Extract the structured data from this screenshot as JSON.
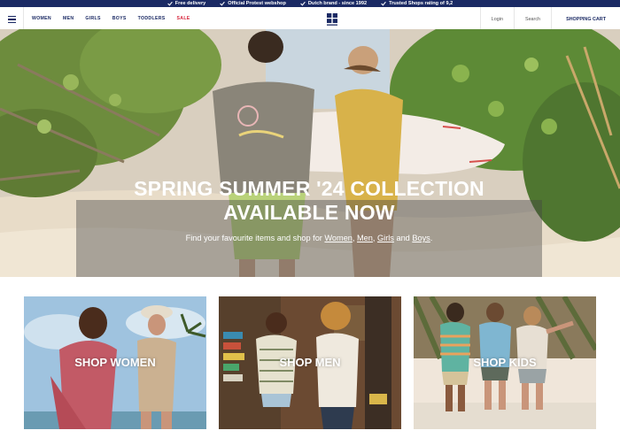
{
  "usp_bar": {
    "items": [
      "Free delivery",
      "Official Protest webshop",
      "Dutch brand - since 1992",
      "Trusted Shops rating of 9,2"
    ]
  },
  "header": {
    "nav": [
      "WOMEN",
      "MEN",
      "GIRLS",
      "BOYS",
      "TODDLERS",
      "SALE"
    ],
    "logo_text": "PROTEST",
    "login": "Login",
    "search": "Search",
    "cart": "SHOPPING CART"
  },
  "hero": {
    "title_line1": "SPRING SUMMER '24 COLLECTION",
    "title_line2": "AVAILABLE NOW",
    "subtitle_prefix": "Find your favourite items and shop for ",
    "links": [
      "Women",
      "Men",
      "Girls",
      "Boys"
    ],
    "sep1": ", ",
    "sep2": ", ",
    "sep3": " and ",
    "subtitle_suffix": "."
  },
  "categories": [
    {
      "label": "SHOP WOMEN"
    },
    {
      "label": "SHOP MEN"
    },
    {
      "label": "SHOP KIDS"
    }
  ],
  "colors": {
    "brand_navy": "#1b2a64",
    "sale_red": "#d7263d"
  }
}
